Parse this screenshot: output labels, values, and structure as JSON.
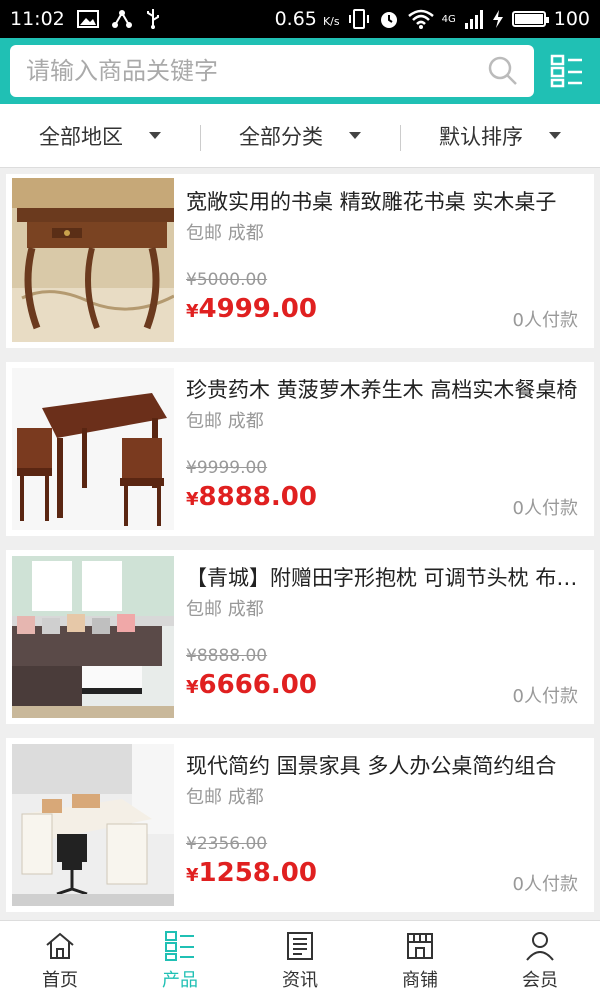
{
  "status_bar": {
    "time": "11:02",
    "speed": "0.65",
    "speed_unit": "K/s",
    "network": "4G",
    "battery": "100",
    "battery_level": 1.0
  },
  "header": {
    "search_placeholder": "请输入商品关键字",
    "accent_color": "#20c0b4"
  },
  "filters": [
    {
      "label": "全部地区"
    },
    {
      "label": "全部分类"
    },
    {
      "label": "默认排序"
    }
  ],
  "products": [
    {
      "title": "宽敞实用的书桌 精致雕花书桌 实木桌子",
      "tags": "包邮 成都",
      "old_price": "¥5000.00",
      "price_symbol": "¥",
      "price": "4999.00",
      "sold": "0人付款",
      "image": "carved-wooden-desk"
    },
    {
      "title": "珍贵药木 黄菠萝木养生木 高档实木餐桌椅",
      "tags": "包邮 成都",
      "old_price": "¥9999.00",
      "price_symbol": "¥",
      "price": "8888.00",
      "sold": "0人付款",
      "image": "wooden-dining-set"
    },
    {
      "title": "【青城】附赠田字形抱枕 可调节头枕 布艺沙发",
      "tags": "包邮 成都",
      "old_price": "¥8888.00",
      "price_symbol": "¥",
      "price": "6666.00",
      "sold": "0人付款",
      "image": "sectional-sofa"
    },
    {
      "title": "现代简约 国景家具 多人办公桌简约组合",
      "tags": "包邮 成都",
      "old_price": "¥2356.00",
      "price_symbol": "¥",
      "price": "1258.00",
      "sold": "0人付款",
      "image": "office-desk-set"
    }
  ],
  "bottom_nav": [
    {
      "label": "首页",
      "icon": "home-icon",
      "active": false
    },
    {
      "label": "产品",
      "icon": "grid-list-icon",
      "active": true
    },
    {
      "label": "资讯",
      "icon": "news-icon",
      "active": false
    },
    {
      "label": "商铺",
      "icon": "shop-icon",
      "active": false
    },
    {
      "label": "会员",
      "icon": "user-icon",
      "active": false
    }
  ]
}
